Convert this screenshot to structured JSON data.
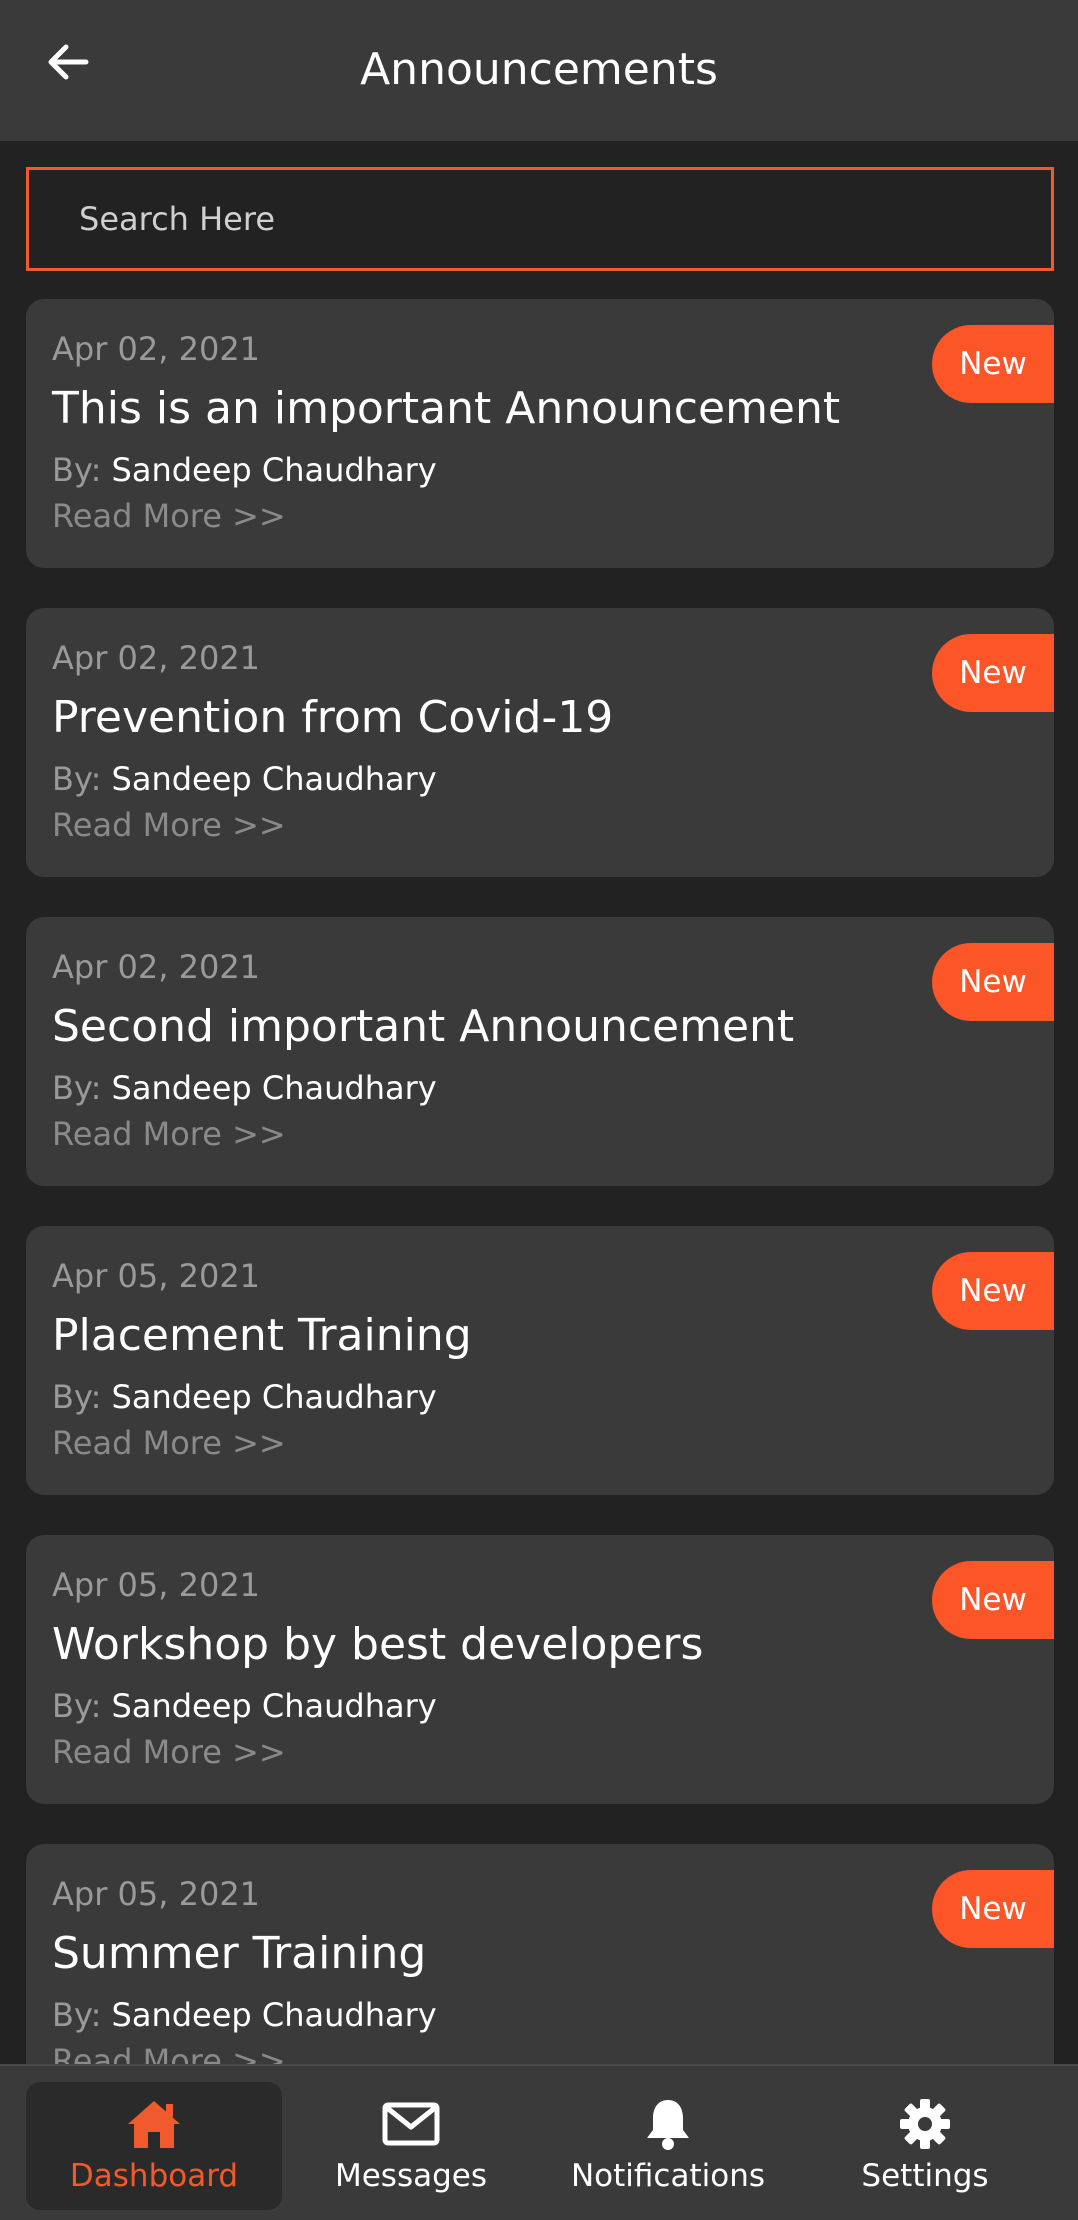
{
  "header": {
    "title": "Announcements",
    "back_icon": "arrow-left-icon"
  },
  "search": {
    "placeholder": "Search Here",
    "value": ""
  },
  "announcements": [
    {
      "date": "Apr 02, 2021",
      "title": "This is an important Announcement",
      "by_label": "By:",
      "author": "Sandeep Chaudhary",
      "read_more": "Read More >>",
      "badge": "New"
    },
    {
      "date": "Apr 02, 2021",
      "title": "Prevention from Covid-19",
      "by_label": "By:",
      "author": "Sandeep Chaudhary",
      "read_more": "Read More >>",
      "badge": "New"
    },
    {
      "date": "Apr 02, 2021",
      "title": "Second important Announcement",
      "by_label": "By:",
      "author": "Sandeep Chaudhary",
      "read_more": "Read More >>",
      "badge": "New"
    },
    {
      "date": "Apr 05, 2021",
      "title": "Placement Training",
      "by_label": "By:",
      "author": "Sandeep Chaudhary",
      "read_more": "Read More >>",
      "badge": "New"
    },
    {
      "date": "Apr 05, 2021",
      "title": "Workshop by best developers",
      "by_label": "By:",
      "author": "Sandeep Chaudhary",
      "read_more": "Read More >>",
      "badge": "New"
    },
    {
      "date": "Apr 05, 2021",
      "title": "Summer Training",
      "by_label": "By:",
      "author": "Sandeep Chaudhary",
      "read_more": "Read More >>",
      "badge": "New"
    }
  ],
  "bottom_nav": [
    {
      "label": "Dashboard",
      "icon": "home-icon",
      "active": true
    },
    {
      "label": "Messages",
      "icon": "envelope-icon",
      "active": false
    },
    {
      "label": "Notifications",
      "icon": "bell-icon",
      "active": false
    },
    {
      "label": "Settings",
      "icon": "gear-icon",
      "active": false
    }
  ],
  "colors": {
    "accent": "#f05a2d",
    "badge": "#fb5528",
    "background": "#222222",
    "surface": "#3a3a3a"
  }
}
